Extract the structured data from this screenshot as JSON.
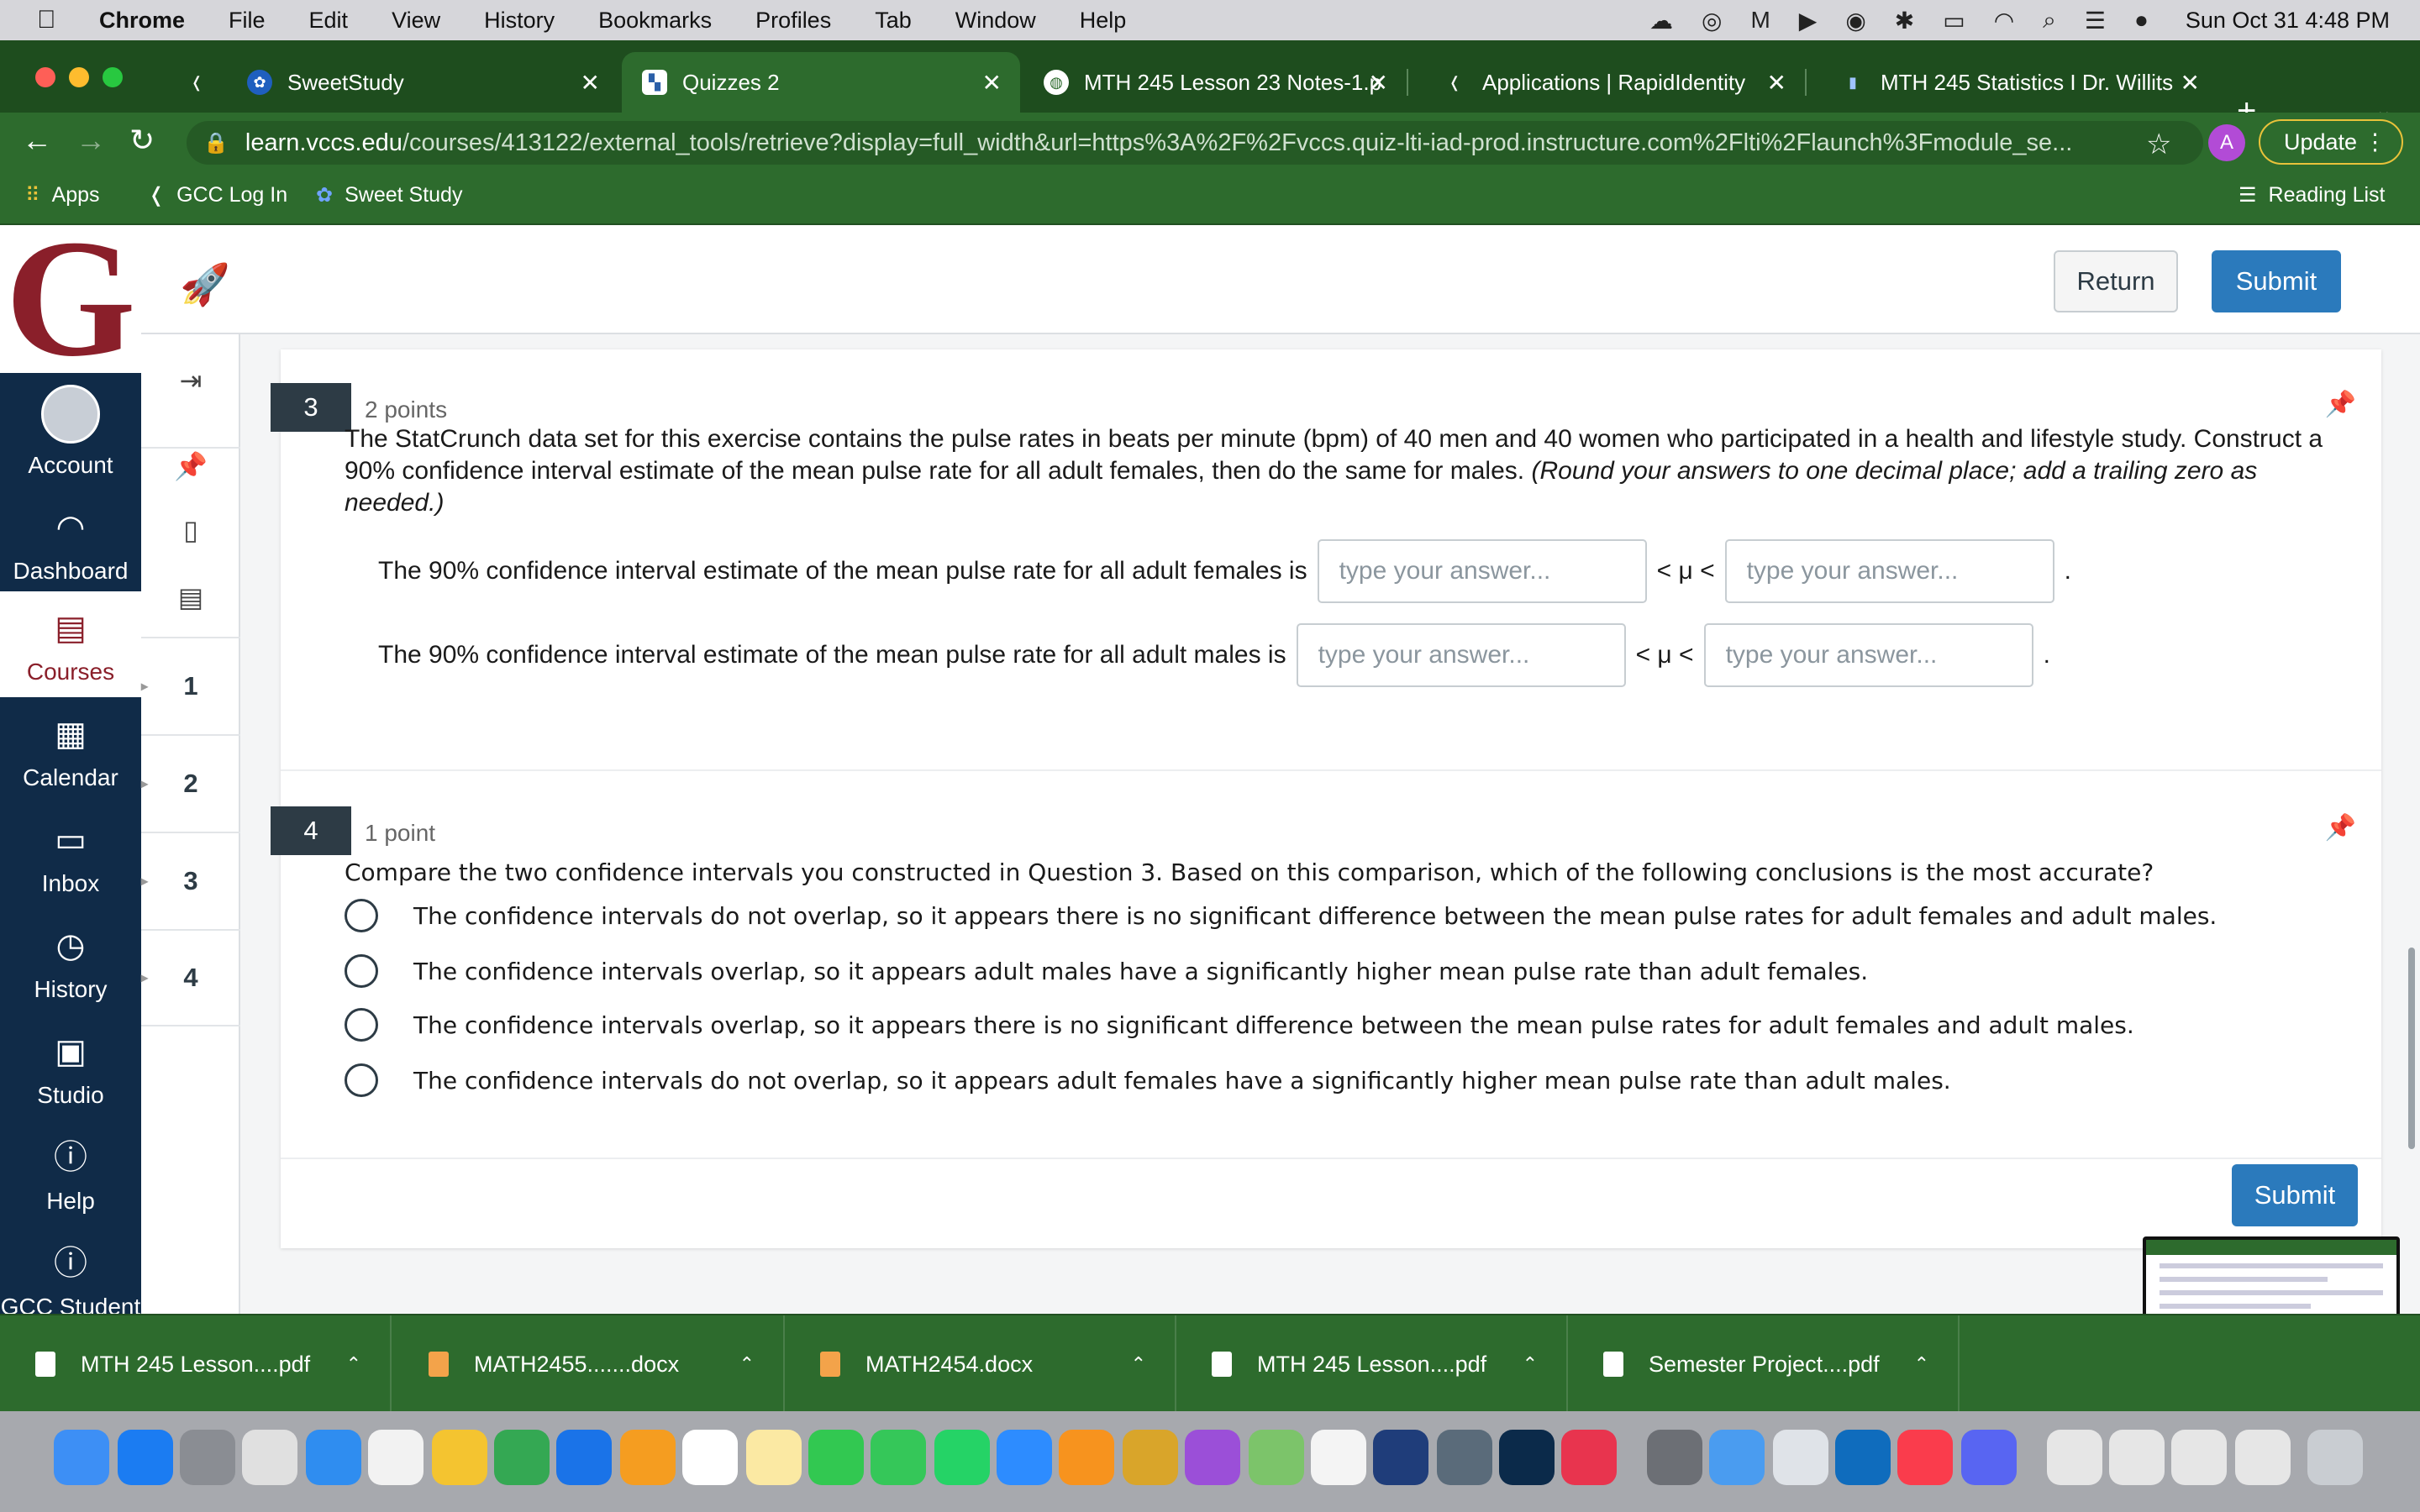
{
  "menubar": {
    "apple": "",
    "app": "Chrome",
    "items": [
      "File",
      "Edit",
      "View",
      "History",
      "Bookmarks",
      "Profiles",
      "Tab",
      "Window",
      "Help"
    ],
    "clock": "Sun Oct 31  4:48 PM"
  },
  "browser": {
    "tabs": [
      {
        "title": "SweetStudy",
        "active": false
      },
      {
        "title": "Quizzes 2",
        "active": true
      },
      {
        "title": "MTH 245 Lesson 23 Notes-1.p",
        "active": false
      },
      {
        "title": "Applications | RapidIdentity",
        "active": false
      },
      {
        "title": "MTH 245 Statistics I Dr. Willits",
        "active": false
      }
    ],
    "url_host": "learn.vccs.edu",
    "url_path": "/courses/413122/external_tools/retrieve?display=full_width&url=https%3A%2F%2Fvccs.quiz-lti-iad-prod.instructure.com%2Flti%2Flaunch%3Fmodule_se...",
    "profile_initial": "A",
    "update_label": "Update",
    "bookmarks": [
      "Apps",
      "GCC Log In",
      "Sweet Study"
    ],
    "reading_list": "Reading List"
  },
  "global_nav": {
    "logo": "G",
    "items": [
      {
        "label": "Account",
        "icon": "account-icon"
      },
      {
        "label": "Dashboard",
        "icon": "dashboard-icon"
      },
      {
        "label": "Courses",
        "icon": "courses-icon",
        "active": true
      },
      {
        "label": "Calendar",
        "icon": "calendar-icon"
      },
      {
        "label": "Inbox",
        "icon": "inbox-icon"
      },
      {
        "label": "History",
        "icon": "history-icon"
      },
      {
        "label": "Studio",
        "icon": "studio-icon"
      },
      {
        "label": "Help",
        "icon": "help-icon"
      },
      {
        "label": "GCC Student",
        "icon": "info-icon"
      }
    ]
  },
  "quiz": {
    "return_label": "Return",
    "submit_label": "Submit",
    "question_nav": [
      "1",
      "2",
      "3",
      "4"
    ],
    "q3": {
      "number": "3",
      "points": "2 points",
      "text": "The StatCrunch data set for this exercise contains the pulse rates in beats per minute (bpm) of 40 men and 40 women who participated in a health and lifestyle study. Construct a 90% confidence interval estimate of the mean pulse rate for all adult females, then do the same for males.",
      "note": "(Round your answers to one decimal place; add a trailing zero as needed.)",
      "female_label": "The 90% confidence interval estimate of the mean pulse rate for all adult females is",
      "male_label": "The 90% confidence interval estimate of the mean pulse rate for all adult males is",
      "mu": "< μ <",
      "period": ".",
      "placeholder": "type your answer..."
    },
    "q4": {
      "number": "4",
      "points": "1 point",
      "text": "Compare the two confidence intervals you constructed in Question 3. Based on this comparison, which of the following conclusions is the most accurate?",
      "options": [
        "The confidence intervals do not overlap, so it appears there is no significant difference between the mean pulse rates for adult females and adult males.",
        "The confidence intervals overlap, so it appears adult males have a significantly higher mean pulse rate than adult females.",
        "The confidence intervals overlap, so it appears there is no significant difference between the mean pulse rates for adult females and adult males.",
        "The confidence intervals do not overlap, so it appears adult females have a significantly higher mean pulse rate than adult males."
      ]
    }
  },
  "downloads": [
    "MTH 245 Lesson....pdf",
    "MATH2455.......docx",
    "MATH2454.docx",
    "MTH 245 Lesson....pdf",
    "Semester Project....pdf"
  ],
  "colors": {
    "chrome_green": "#2d6b2d",
    "canvas_nav": "#102b48",
    "brand_red": "#8a1f2a",
    "submit_blue": "#2b7abc"
  }
}
